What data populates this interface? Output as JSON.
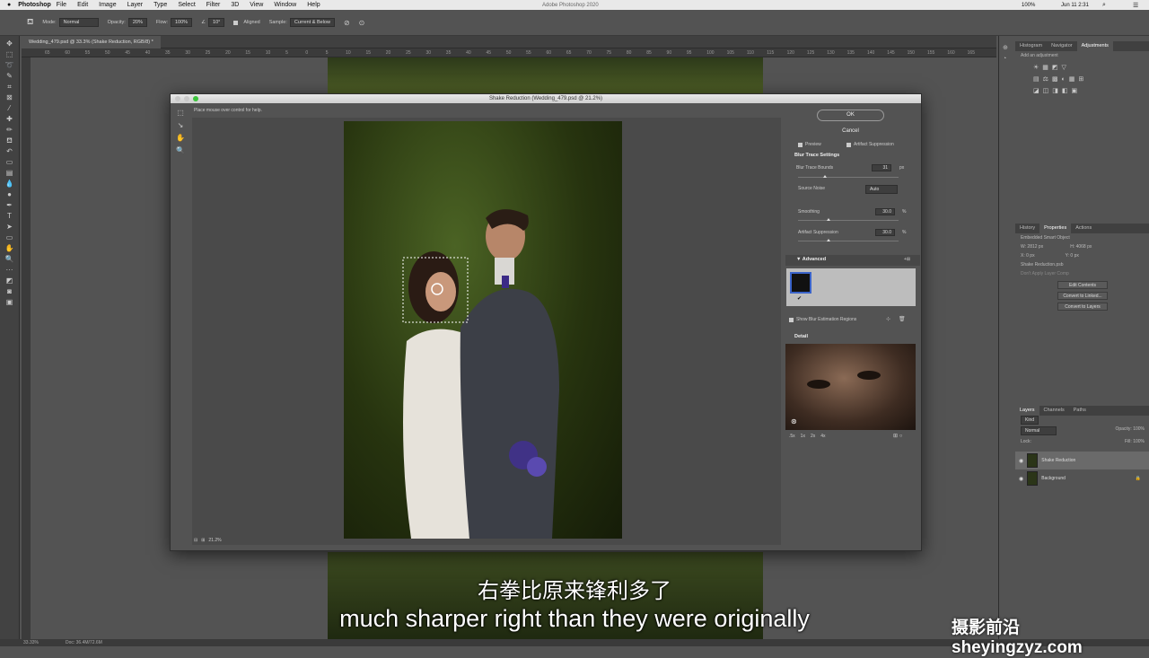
{
  "menubar": {
    "app": "Photoshop",
    "items": [
      "File",
      "Edit",
      "Image",
      "Layer",
      "Type",
      "Select",
      "Filter",
      "3D",
      "View",
      "Window",
      "Help"
    ],
    "window_title": "Adobe Photoshop 2020",
    "battery": "100%",
    "clock": "Jun 11  2:31"
  },
  "options": {
    "mode_label": "Mode:",
    "mode": "Normal",
    "opacity_label": "Opacity:",
    "opacity": "20%",
    "flow_label": "Flow:",
    "flow": "100%",
    "angle": "10°",
    "aligned_label": "Aligned",
    "sample_label": "Sample:",
    "sample": "Current & Below"
  },
  "document": {
    "tab": "Wedding_479.psd @ 33.3% (Shake Reduction, RGB/8) *",
    "ruler": [
      "65",
      "60",
      "55",
      "50",
      "45",
      "40",
      "35",
      "30",
      "25",
      "20",
      "15",
      "10",
      "5",
      "0",
      "5",
      "10",
      "15",
      "20",
      "25",
      "30",
      "35",
      "40",
      "45",
      "50",
      "55",
      "60",
      "65",
      "70",
      "75",
      "80",
      "85",
      "90",
      "95",
      "100",
      "105",
      "110",
      "115",
      "120",
      "125",
      "130",
      "135",
      "140",
      "145",
      "150",
      "155",
      "160",
      "165"
    ]
  },
  "status": {
    "zoom": "33.33%",
    "doc": "Doc: 36.4M/72.6M"
  },
  "dialog": {
    "title": "Shake Reduction (Wedding_479.psd @ 21.2%)",
    "help": "Place mouse over control for help.",
    "ok": "OK",
    "cancel": "Cancel",
    "preview": "Preview",
    "artifact_suppression_chk": "Artifact Suppression",
    "blur_trace_settings": "Blur Trace Settings",
    "blur_trace_bounds": "Blur Trace Bounds",
    "blur_trace_bounds_val": "31",
    "px": "px",
    "source_noise": "Source Noise",
    "source_noise_val": "Auto",
    "smoothing": "Smoothing",
    "smoothing_val": "30.0",
    "pct": "%",
    "artifact_suppression": "Artifact Suppression",
    "artifact_val": "30.0",
    "advanced": "Advanced",
    "show_blur_regions": "Show Blur Estimation Regions",
    "detail": "Detail",
    "zoom": "21.2%",
    "detail_zooms": [
      ".5x",
      "1x",
      "2x",
      "4x"
    ]
  },
  "panels": {
    "top_tabs": [
      "Histogram",
      "Navigator",
      "Adjustments"
    ],
    "add_adjustment": "Add an adjustment",
    "mid_tabs": [
      "History",
      "Properties",
      "Actions"
    ],
    "smart_object": "Embedded Smart Object",
    "w": "W: 2812 px",
    "h": "H: 4068 px",
    "x": "X: 0 px",
    "y": "Y: 0 px",
    "filename": "Shake Reduction.psb",
    "layer_comp": "Don't Apply Layer Comp",
    "edit_contents": "Edit Contents",
    "convert_linked": "Convert to Linked...",
    "convert_layers": "Convert to Layers",
    "bottom_tabs": [
      "Layers",
      "Channels",
      "Paths"
    ],
    "kind": "Kind",
    "blend": "Normal",
    "opacity_label": "Opacity:",
    "opacity": "100%",
    "lock_label": "Lock:",
    "fill_label": "Fill:",
    "fill": "100%",
    "layers": [
      {
        "name": "Shake Reduction"
      },
      {
        "name": "Background"
      }
    ]
  },
  "subtitles": {
    "zh": "右拳比原来锋利多了",
    "en": "much sharper right than they were originally"
  },
  "watermark": "摄影前沿 sheyingzyz.com"
}
